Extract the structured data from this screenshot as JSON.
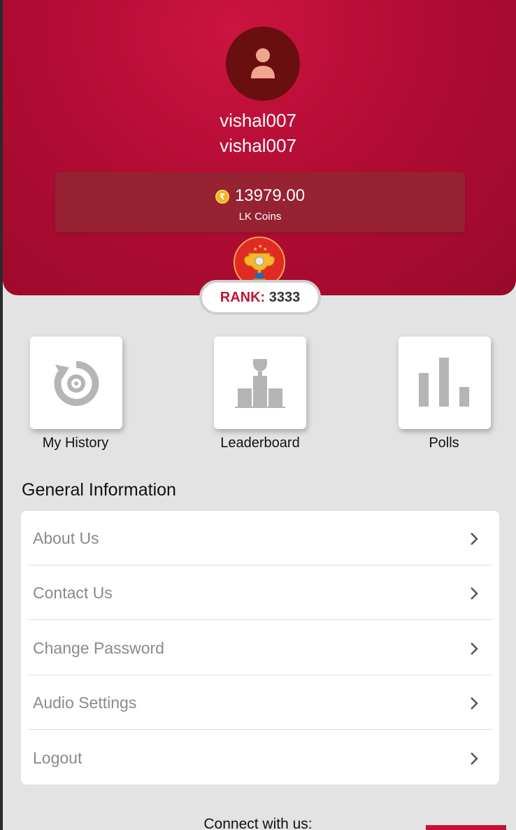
{
  "profile": {
    "username": "vishal007",
    "display_name": "vishal007",
    "coins": "13979.00",
    "coins_label": "LK Coins",
    "coin_symbol": "₹",
    "rank_label": "RANK:",
    "rank_value": "3333"
  },
  "shortcuts": [
    {
      "label": "My History",
      "icon": "history-icon"
    },
    {
      "label": "Leaderboard",
      "icon": "leaderboard-icon"
    },
    {
      "label": "Polls",
      "icon": "polls-icon"
    }
  ],
  "general": {
    "title": "General Information",
    "items": [
      {
        "label": "About Us"
      },
      {
        "label": "Contact Us"
      },
      {
        "label": "Change Password"
      },
      {
        "label": "Audio Settings"
      },
      {
        "label": "Logout"
      }
    ]
  },
  "footer": {
    "connect_label": "Connect with us:"
  },
  "colors": {
    "brand": "#c31238",
    "background": "#e3e3e3"
  }
}
